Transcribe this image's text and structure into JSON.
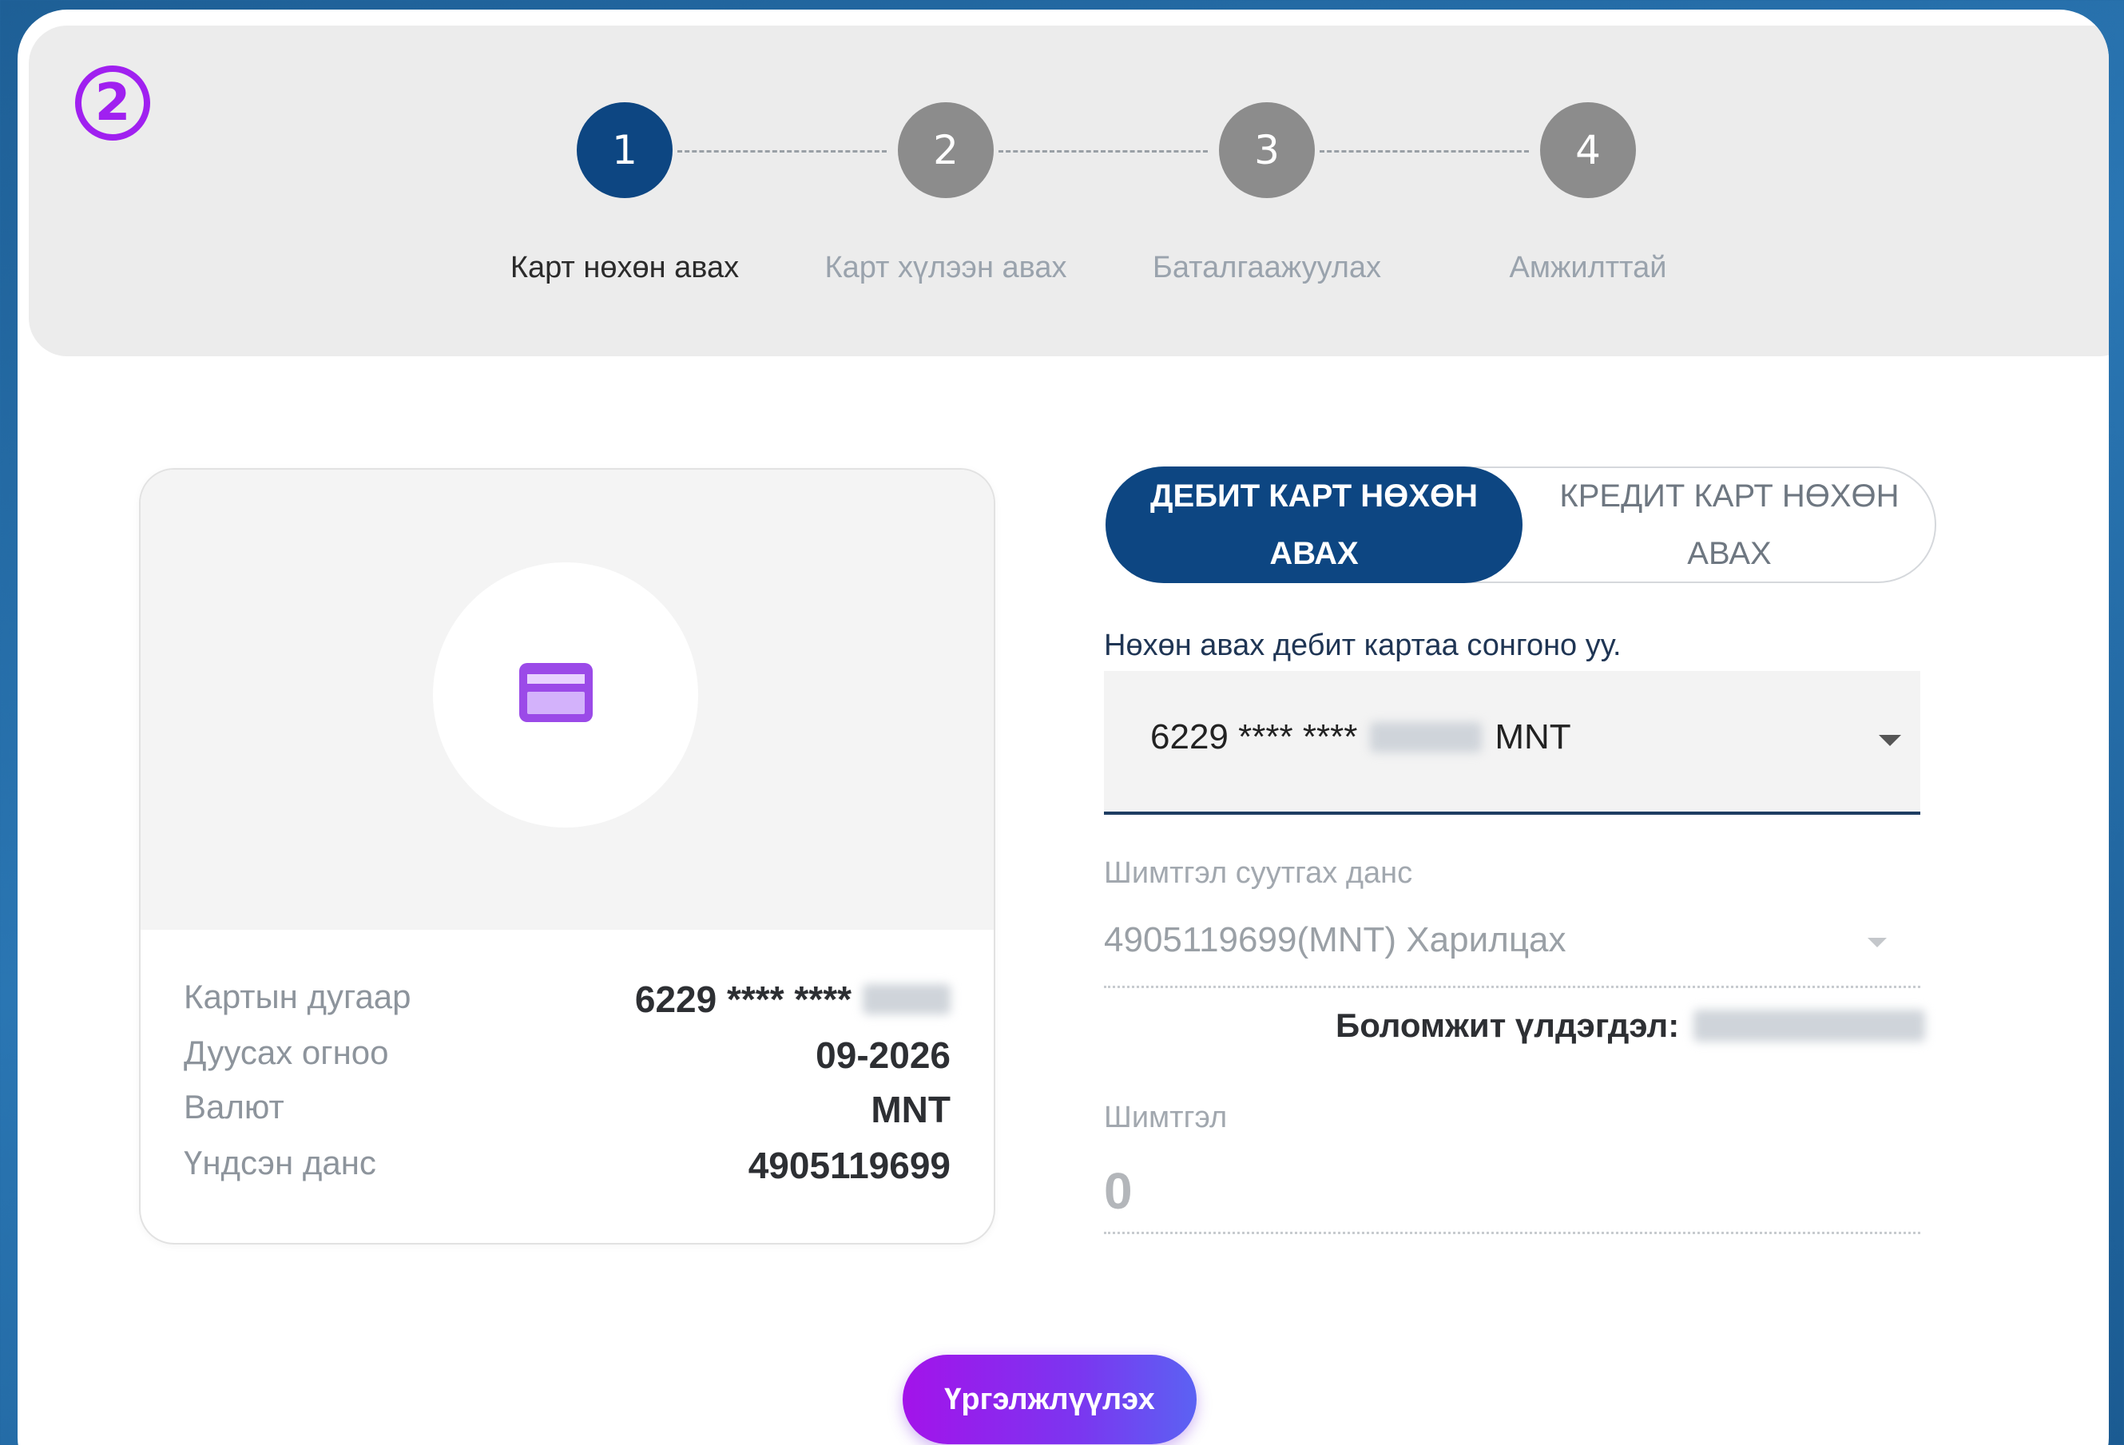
{
  "tutorial_badge": "2",
  "stepper": {
    "steps": [
      {
        "number": "1",
        "label": "Карт нөхөн авах",
        "state": "active"
      },
      {
        "number": "2",
        "label": "Карт хүлээн авах",
        "state": "inactive"
      },
      {
        "number": "3",
        "label": "Баталгаажуулах",
        "state": "inactive"
      },
      {
        "number": "4",
        "label": "Амжилттай",
        "state": "inactive"
      }
    ],
    "active_color": "#0d4682",
    "inactive_color": "#8c8c8c"
  },
  "card_preview": {
    "icon": "credit-card-icon",
    "rows": [
      {
        "label": "Картын дугаар",
        "value": "6229 **** ****"
      },
      {
        "label": "Дуусах огноо",
        "value": "09-2026"
      },
      {
        "label": "Валют",
        "value": "MNT"
      },
      {
        "label": "Үндсэн данс",
        "value": "4905119699"
      }
    ]
  },
  "toggle": {
    "debit_line1": "ДЕБИТ КАРТ НӨХӨН",
    "debit_line2": "АВАХ",
    "credit_line1": "КРЕДИТ КАРТ НӨХӨН",
    "credit_line2": "АВАХ",
    "active": "debit"
  },
  "form": {
    "select_card_caption": "Нөхөн авах дебит картаа сонгоно уу.",
    "selected_card_prefix": "6229 **** ****",
    "selected_card_currency": "MNT",
    "fee_account_label": "Шимтгэл суутгах данс",
    "fee_account_value": "4905119699(MNT) Харилцах",
    "available_balance_label": "Боломжит үлдэгдэл:",
    "fee_label": "Шимтгэл",
    "fee_value": "0"
  },
  "continue_button": "Үргэлжлүүлэх",
  "colors": {
    "primary": "#0d4682",
    "accent": "#a020f0",
    "button_gradient_start": "#a313ea",
    "button_gradient_end": "#5b62f3"
  }
}
